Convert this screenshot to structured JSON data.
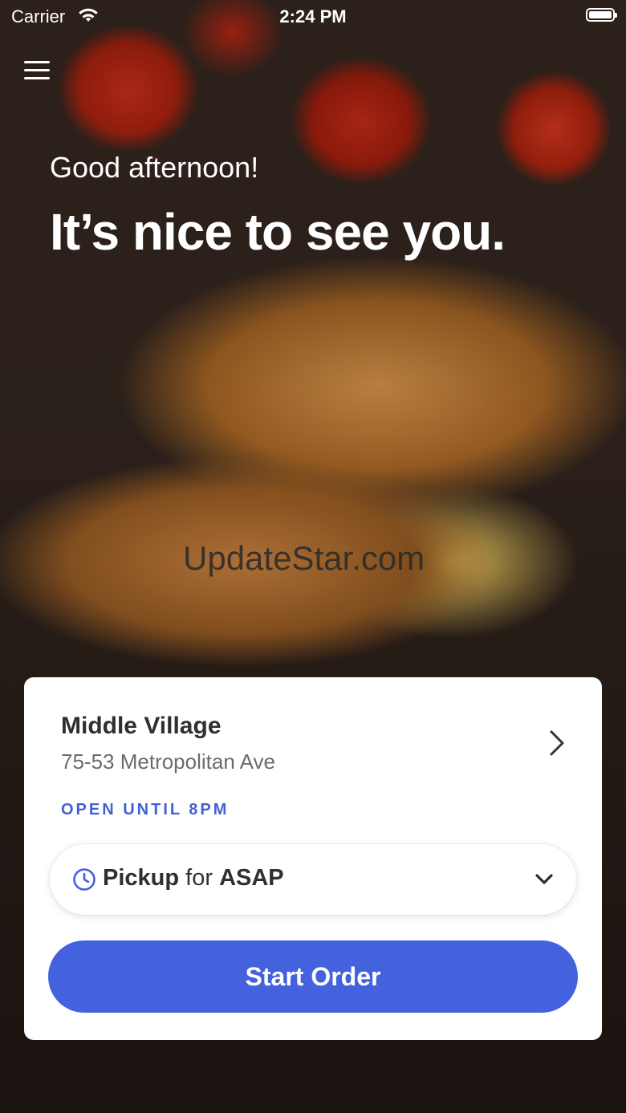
{
  "status_bar": {
    "carrier": "Carrier",
    "time": "2:24 PM"
  },
  "hero": {
    "greeting": "Good afternoon!",
    "headline": "It’s nice to see you."
  },
  "watermark": "UpdateStar.com",
  "location": {
    "name": "Middle Village",
    "address": "75-53 Metropolitan Ave",
    "hours": "OPEN UNTIL 8PM"
  },
  "order_mode": {
    "mode": "Pickup",
    "connector": "for",
    "time": "ASAP"
  },
  "start_button_label": "Start Order",
  "colors": {
    "accent": "#4462dd",
    "status_text": "#4460d6"
  }
}
